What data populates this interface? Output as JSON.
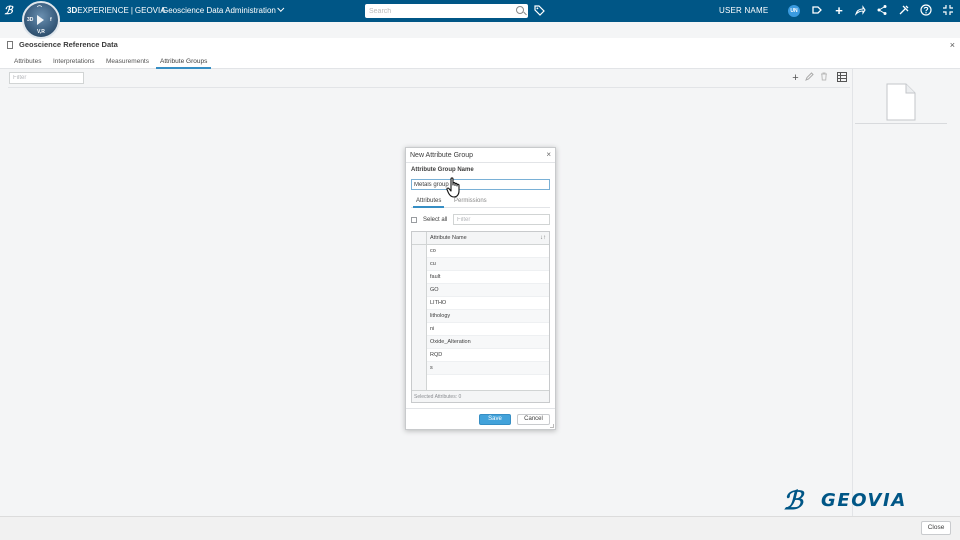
{
  "topbar": {
    "brand_bold": "3D",
    "brand_main": "EXPERIENCE",
    "brand_sep": "|",
    "brand_product": "GEOVIA",
    "app_title": "Geoscience Data Administration",
    "search_placeholder": "Search",
    "username": "USER NAME",
    "avatar_initials": "UN",
    "compass": {
      "n": "3D",
      "s": "V,R",
      "e": "f"
    }
  },
  "panel": {
    "title": "Geoscience Reference Data",
    "close_glyph": "×"
  },
  "tabs": [
    {
      "label": "Attributes",
      "active": false
    },
    {
      "label": "Interpretations",
      "active": false
    },
    {
      "label": "Measurements",
      "active": false
    },
    {
      "label": "Attribute Groups",
      "active": true
    }
  ],
  "content": {
    "filter_placeholder": "Filter"
  },
  "modal": {
    "title": "New Attribute Group",
    "close_glyph": "×",
    "name_label": "Attribute Group Name",
    "name_value": "Metals group",
    "tabs": [
      {
        "label": "Attributes",
        "active": true
      },
      {
        "label": "Permissions",
        "active": false
      }
    ],
    "select_all_label": "Select all",
    "filter_placeholder": "Filter",
    "column_header": "Attribute Name",
    "rows": [
      "co",
      "cu",
      "fault",
      "GO",
      "LITHO",
      "lithology",
      "ni",
      "Oxide_Alteration",
      "RQD",
      "s"
    ],
    "footer_status": "Selected Attributes: 0",
    "save_label": "Save",
    "cancel_label": "Cancel"
  },
  "bottombar": {
    "close_label": "Close"
  },
  "watermark": {
    "word": "GEOVIA"
  },
  "colors": {
    "topbar": "#005686",
    "accent": "#368ec4",
    "save_button": "#42a2da"
  }
}
